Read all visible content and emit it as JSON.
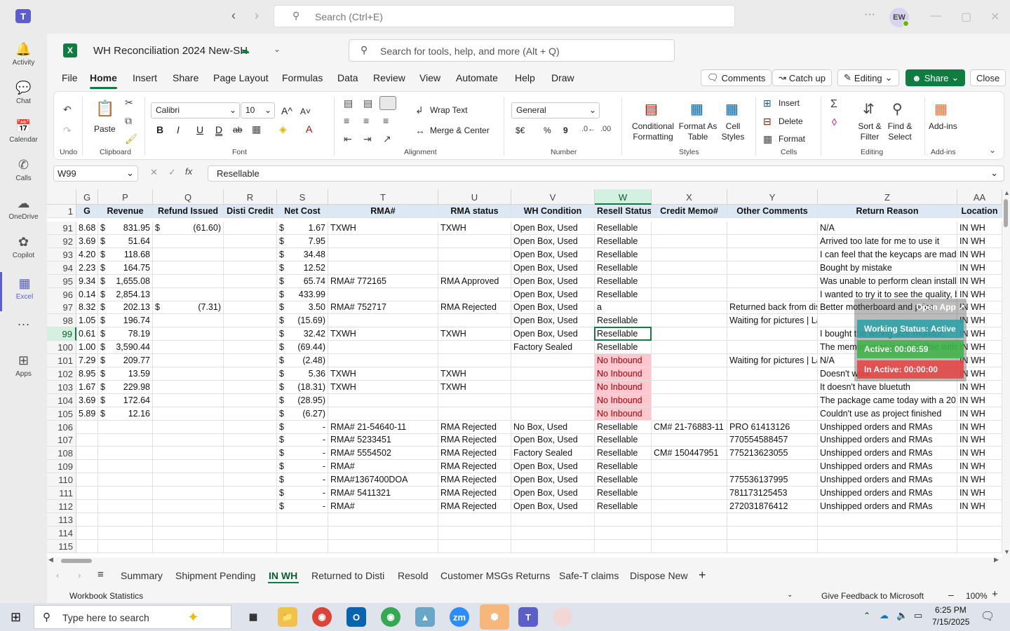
{
  "teams": {
    "search_placeholder": "Search (Ctrl+E)",
    "avatar_initials": "EW",
    "rail": [
      {
        "label": "Activity",
        "icon": "bell-icon"
      },
      {
        "label": "Chat",
        "icon": "chat-icon"
      },
      {
        "label": "Calendar",
        "icon": "calendar-icon"
      },
      {
        "label": "Calls",
        "icon": "phone-icon"
      },
      {
        "label": "OneDrive",
        "icon": "cloud-icon"
      },
      {
        "label": "Copilot",
        "icon": "copilot-icon"
      },
      {
        "label": "Excel",
        "icon": "excel-icon"
      },
      {
        "label": "Apps",
        "icon": "plus-icon"
      }
    ]
  },
  "excel": {
    "workbook_title": "WH Reconciliation 2024 New-SH",
    "search_placeholder": "Search for tools, help, and more (Alt + Q)",
    "menu": [
      "File",
      "Home",
      "Insert",
      "Share",
      "Page Layout",
      "Formulas",
      "Data",
      "Review",
      "View",
      "Automate",
      "Help",
      "Draw"
    ],
    "actions": {
      "comments": "Comments",
      "catchup": "Catch up",
      "editing": "Editing",
      "share": "Share",
      "close": "Close"
    },
    "ribbon": {
      "undo": "Undo",
      "paste": "Paste",
      "clipboard": "Clipboard",
      "font_name": "Calibri",
      "font_size": "10",
      "font": "Font",
      "wrap_text": "Wrap Text",
      "merge_center": "Merge & Center",
      "alignment": "Alignment",
      "number_format": "General",
      "number": "Number",
      "currency_symbol": "$€",
      "percent_symbol": "%",
      "comma_symbol": "9",
      "bold_symbol": "B",
      "italic_symbol": "I",
      "underline_symbol": "U",
      "double_underline_symbol": "D",
      "strike_symbol": "ab",
      "grow_font_symbol": "A^",
      "shrink_font_symbol": "A˅",
      "conditional_formatting": "Conditional Formatting",
      "format_as_table": "Format As Table",
      "cell_styles": "Cell Styles",
      "styles": "Styles",
      "insert": "Insert",
      "delete": "Delete",
      "format": "Format",
      "cells": "Cells",
      "sort_filter": "Sort & Filter",
      "find_select": "Find & Select",
      "editing": "Editing",
      "addins": "Add-ins",
      "addins_group": "Add-ins"
    },
    "name_box": "W99",
    "formula_value": "Resellable",
    "fx_label": "fx",
    "columns": [
      "G",
      "P",
      "Q",
      "R",
      "S",
      "T",
      "U",
      "V",
      "W",
      "X",
      "Y",
      "Z",
      "AA"
    ],
    "header_row_number": "1",
    "headers": [
      "G",
      "Revenue",
      "Refund Issued",
      "Disti Credit",
      "Net Cost",
      "RMA#",
      "RMA status",
      "WH Condition",
      "Resell Status",
      "Credit Memo#",
      "Other Comments",
      "Return Reason",
      "Location"
    ],
    "rows": [
      {
        "n": "91",
        "g": "8.68",
        "rev_d": "$",
        "rev": "831.95",
        "ref_d": "$",
        "ref": "(61.60)",
        "nc_d": "$",
        "nc": "1.67",
        "rma": "TXWH",
        "rmas": "TXWH",
        "wh": "Open Box, Used",
        "rs": "Resellable",
        "cm": "",
        "oc": "",
        "rr": "N/A",
        "loc": "IN WH",
        "red": false
      },
      {
        "n": "92",
        "g": "3.69",
        "rev_d": "$",
        "rev": "51.64",
        "ref_d": "",
        "ref": "",
        "nc_d": "$",
        "nc": "7.95",
        "rma": "",
        "rmas": "",
        "wh": "Open Box, Used",
        "rs": "Resellable",
        "cm": "",
        "oc": "",
        "rr": "Arrived too late for me to use it",
        "loc": "IN WH",
        "red": false
      },
      {
        "n": "93",
        "g": "4.20",
        "rev_d": "$",
        "rev": "118.68",
        "ref_d": "",
        "ref": "",
        "nc_d": "$",
        "nc": "34.48",
        "rma": "",
        "rmas": "",
        "wh": "Open Box, Used",
        "rs": "Resellable",
        "cm": "",
        "oc": "",
        "rr": "I can feel that the keycaps are made",
        "loc": "IN WH",
        "red": false
      },
      {
        "n": "94",
        "g": "2.23",
        "rev_d": "$",
        "rev": "164.75",
        "ref_d": "",
        "ref": "",
        "nc_d": "$",
        "nc": "12.52",
        "rma": "",
        "rmas": "",
        "wh": "Open Box, Used",
        "rs": "Resellable",
        "cm": "",
        "oc": "",
        "rr": "Bought by mistake",
        "loc": "IN WH",
        "red": false
      },
      {
        "n": "95",
        "g": "9.34",
        "rev_d": "$",
        "rev": "1,655.08",
        "ref_d": "",
        "ref": "",
        "nc_d": "$",
        "nc": "65.74",
        "rma": "RMA# 772165",
        "rmas": "RMA Approved",
        "wh": "Open Box, Used",
        "rs": "Resellable",
        "cm": "",
        "oc": "",
        "rr": "Was unable to perform clean install o",
        "loc": "IN WH",
        "red": false
      },
      {
        "n": "96",
        "g": "0.14",
        "rev_d": "$",
        "rev": "2,854.13",
        "ref_d": "",
        "ref": "",
        "nc_d": "$",
        "nc": "433.99",
        "rma": "",
        "rmas": "",
        "wh": "Open Box, Used",
        "rs": "Resellable",
        "cm": "",
        "oc": "",
        "rr": "I wanted to try it to see the quality, b",
        "loc": "IN WH",
        "red": false
      },
      {
        "n": "97",
        "g": "8.32",
        "rev_d": "$",
        "rev": "202.13",
        "ref_d": "$",
        "ref": "(7.31)",
        "nc_d": "$",
        "nc": "3.50",
        "rma": "RMA# 752717",
        "rmas": "RMA Rejected",
        "wh": "Open Box, Used",
        "rs": "a",
        "cm": "",
        "oc": "Returned back from dis",
        "rr": "Better motherboard and price",
        "loc": "IN WH",
        "red": false
      },
      {
        "n": "98",
        "g": "1.05",
        "rev_d": "$",
        "rev": "196.74",
        "ref_d": "",
        "ref": "",
        "nc_d": "$",
        "nc": "(15.69)",
        "rma": "",
        "rmas": "",
        "wh": "Open Box, Used",
        "rs": "Resellable",
        "cm": "",
        "oc": "Waiting for pictures | Label sent but not in use",
        "rr": "",
        "loc": "IN WH",
        "red": false
      },
      {
        "n": "99",
        "g": "0.61",
        "rev_d": "$",
        "rev": "78.19",
        "ref_d": "",
        "ref": "",
        "nc_d": "$",
        "nc": "32.42",
        "rma": "TXWH",
        "rmas": "TXWH",
        "wh": "Open Box, Used",
        "rs": "Resellable",
        "cm": "",
        "oc": "",
        "rr": "I bought the wrong size monitor.",
        "loc": "IN WH",
        "red": false
      },
      {
        "n": "100",
        "g": "1.00",
        "rev_d": "$",
        "rev": "3,590.44",
        "ref_d": "",
        "ref": "",
        "nc_d": "$",
        "nc": "(69.44)",
        "rma": "",
        "rmas": "",
        "wh": "Factory Sealed",
        "rs": "Resellable",
        "cm": "",
        "oc": "",
        "rr": "The memory was incompatible with the s",
        "loc": "IN WH",
        "red": false
      },
      {
        "n": "101",
        "g": "7.29",
        "rev_d": "$",
        "rev": "209.77",
        "ref_d": "",
        "ref": "",
        "nc_d": "$",
        "nc": "(2.48)",
        "rma": "",
        "rmas": "",
        "wh": "",
        "rs": "No Inbound",
        "cm": "",
        "oc": "Waiting for pictures | La",
        "rr": "N/A",
        "loc": "IN WH",
        "red": true
      },
      {
        "n": "102",
        "g": "8.95",
        "rev_d": "$",
        "rev": "13.59",
        "ref_d": "",
        "ref": "",
        "nc_d": "$",
        "nc": "5.36",
        "rma": "TXWH",
        "rmas": "TXWH",
        "wh": "",
        "rs": "No Inbound",
        "cm": "",
        "oc": "",
        "rr": "Doesn't work",
        "loc": "IN WH",
        "red": true
      },
      {
        "n": "103",
        "g": "1.67",
        "rev_d": "$",
        "rev": "229.98",
        "ref_d": "",
        "ref": "",
        "nc_d": "$",
        "nc": "(18.31)",
        "rma": "TXWH",
        "rmas": "TXWH",
        "wh": "",
        "rs": "No Inbound",
        "cm": "",
        "oc": "",
        "rr": "It doesn't have bluetuth",
        "loc": "IN WH",
        "red": true
      },
      {
        "n": "104",
        "g": "3.69",
        "rev_d": "$",
        "rev": "172.64",
        "ref_d": "",
        "ref": "",
        "nc_d": "$",
        "nc": "(28.95)",
        "rma": "",
        "rmas": "",
        "wh": "",
        "rs": "No Inbound",
        "cm": "",
        "oc": "",
        "rr": "The package came today with a 20 p",
        "loc": "IN WH",
        "red": true
      },
      {
        "n": "105",
        "g": "5.89",
        "rev_d": "$",
        "rev": "12.16",
        "ref_d": "",
        "ref": "",
        "nc_d": "$",
        "nc": "(6.27)",
        "rma": "",
        "rmas": "",
        "wh": "",
        "rs": "No Inbound",
        "cm": "",
        "oc": "",
        "rr": "Couldn't use as project finished",
        "loc": "IN WH",
        "red": true
      },
      {
        "n": "106",
        "g": "",
        "rev_d": "",
        "rev": "",
        "ref_d": "",
        "ref": "",
        "nc_d": "$",
        "nc": "-",
        "rma": "RMA# 21-54640-11",
        "rmas": "RMA Rejected",
        "wh": "No Box, Used",
        "rs": "Resellable",
        "cm": "CM# 21-76883-11",
        "oc": "PRO 61413126",
        "rr": "Unshipped orders and RMAs",
        "loc": "IN WH",
        "red": false
      },
      {
        "n": "107",
        "g": "",
        "rev_d": "",
        "rev": "",
        "ref_d": "",
        "ref": "",
        "nc_d": "$",
        "nc": "-",
        "rma": "RMA# 5233451",
        "rmas": "RMA Rejected",
        "wh": "Open Box, Used",
        "rs": "Resellable",
        "cm": "",
        "oc": "770554588457",
        "rr": "Unshipped orders and RMAs",
        "loc": "IN WH",
        "red": false
      },
      {
        "n": "108",
        "g": "",
        "rev_d": "",
        "rev": "",
        "ref_d": "",
        "ref": "",
        "nc_d": "$",
        "nc": "-",
        "rma": "RMA# 5554502",
        "rmas": "RMA Rejected",
        "wh": "Factory Sealed",
        "rs": "Resellable",
        "cm": "CM# 150447951",
        "oc": "775213623055",
        "rr": "Unshipped orders and RMAs",
        "loc": "IN WH",
        "red": false
      },
      {
        "n": "109",
        "g": "",
        "rev_d": "",
        "rev": "",
        "ref_d": "",
        "ref": "",
        "nc_d": "$",
        "nc": "-",
        "rma": "RMA#",
        "rmas": "RMA Rejected",
        "wh": "Open Box, Used",
        "rs": "Resellable",
        "cm": "",
        "oc": "",
        "rr": "Unshipped orders and RMAs",
        "loc": "IN WH",
        "red": false
      },
      {
        "n": "110",
        "g": "",
        "rev_d": "",
        "rev": "",
        "ref_d": "",
        "ref": "",
        "nc_d": "$",
        "nc": "-",
        "rma": "RMA#1367400DOA",
        "rmas": "RMA Rejected",
        "wh": "Open Box, Used",
        "rs": "Resellable",
        "cm": "",
        "oc": "775536137995",
        "rr": "Unshipped orders and RMAs",
        "loc": "IN WH",
        "red": false
      },
      {
        "n": "111",
        "g": "",
        "rev_d": "",
        "rev": "",
        "ref_d": "",
        "ref": "",
        "nc_d": "$",
        "nc": "-",
        "rma": "RMA# 5411321",
        "rmas": "RMA Rejected",
        "wh": "Open Box, Used",
        "rs": "Resellable",
        "cm": "",
        "oc": "781173125453",
        "rr": "Unshipped orders and RMAs",
        "loc": "IN WH",
        "red": false
      },
      {
        "n": "112",
        "g": "",
        "rev_d": "",
        "rev": "",
        "ref_d": "",
        "ref": "",
        "nc_d": "$",
        "nc": "-",
        "rma": "RMA#",
        "rmas": "RMA Rejected",
        "wh": "Open Box, Used",
        "rs": "Resellable",
        "cm": "",
        "oc": "272031876412",
        "rr": "Unshipped orders and RMAs",
        "loc": "IN WH",
        "red": false
      },
      {
        "n": "113",
        "g": "",
        "rev_d": "",
        "rev": "",
        "ref_d": "",
        "ref": "",
        "nc_d": "",
        "nc": "",
        "rma": "",
        "rmas": "",
        "wh": "",
        "rs": "",
        "cm": "",
        "oc": "",
        "rr": "",
        "loc": "",
        "red": false
      },
      {
        "n": "114",
        "g": "",
        "rev_d": "",
        "rev": "",
        "ref_d": "",
        "ref": "",
        "nc_d": "",
        "nc": "",
        "rma": "",
        "rmas": "",
        "wh": "",
        "rs": "",
        "cm": "",
        "oc": "",
        "rr": "",
        "loc": "",
        "red": false
      },
      {
        "n": "115",
        "g": "",
        "rev_d": "",
        "rev": "",
        "ref_d": "",
        "ref": "",
        "nc_d": "",
        "nc": "",
        "rma": "",
        "rmas": "",
        "wh": "",
        "rs": "",
        "cm": "",
        "oc": "",
        "rr": "",
        "loc": "",
        "red": false
      }
    ],
    "widget": {
      "open_app": "Open App ↗",
      "working_status": "Working Status: Active",
      "active": "Active: 00:06:59",
      "inactive": "In Active: 00:00:00"
    },
    "sheet_tabs": [
      "Summary",
      "Shipment Pending",
      "IN WH",
      "Returned to Disti",
      "Resold",
      "Customer MSGs Returns",
      "Safe-T claims",
      "Dispose New"
    ],
    "active_sheet": "IN WH",
    "status": {
      "left": "Workbook Statistics",
      "feedback": "Give Feedback to Microsoft",
      "zoom": "100%"
    }
  },
  "taskbar": {
    "search_placeholder": "Type here to search",
    "time": "6:25 PM",
    "date": "7/15/2025"
  },
  "colors": {
    "excel_green": "#107c41",
    "teams_purple": "#5b5fc7",
    "no_inbound_bg": "#ffc7ce",
    "header_blue": "#dde8f5"
  }
}
